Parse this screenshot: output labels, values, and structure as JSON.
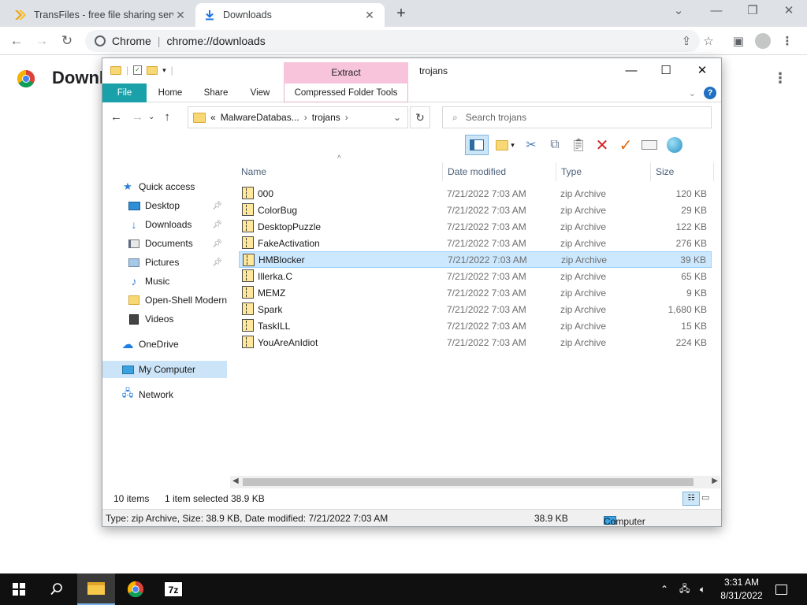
{
  "browser": {
    "tabs": [
      {
        "title": "TransFiles - free file sharing servic",
        "active": false
      },
      {
        "title": "Downloads",
        "active": true
      }
    ],
    "url_prefix": "Chrome",
    "url": "chrome://downloads",
    "page_title": "Downloads"
  },
  "explorer": {
    "title": "trojans",
    "extract_tab": "Extract",
    "ribbon_tabs": [
      "File",
      "Home",
      "Share",
      "View",
      "Compressed Folder Tools"
    ],
    "breadcrumb": [
      "MalwareDatabas...",
      "trojans"
    ],
    "breadcrumb_prefix": "«",
    "search_placeholder": "Search trojans",
    "nav": [
      {
        "label": "Quick access",
        "icon": "star-icon",
        "pinned": false,
        "selected": false
      },
      {
        "label": "Desktop",
        "icon": "desktop-icon",
        "pinned": true,
        "selected": false
      },
      {
        "label": "Downloads",
        "icon": "download-icon",
        "pinned": true,
        "selected": false
      },
      {
        "label": "Documents",
        "icon": "documents-icon",
        "pinned": true,
        "selected": false
      },
      {
        "label": "Pictures",
        "icon": "pictures-icon",
        "pinned": true,
        "selected": false
      },
      {
        "label": "Music",
        "icon": "music-icon",
        "pinned": false,
        "selected": false
      },
      {
        "label": "Open-Shell Modern",
        "icon": "folder-icon",
        "pinned": false,
        "selected": false
      },
      {
        "label": "Videos",
        "icon": "videos-icon",
        "pinned": false,
        "selected": false
      },
      {
        "label": "OneDrive",
        "icon": "cloud-icon",
        "pinned": false,
        "selected": false
      },
      {
        "label": "My Computer",
        "icon": "computer-icon",
        "pinned": false,
        "selected": true
      },
      {
        "label": "Network",
        "icon": "network-icon",
        "pinned": false,
        "selected": false
      }
    ],
    "columns": [
      "Name",
      "Date modified",
      "Type",
      "Size"
    ],
    "files": [
      {
        "name": "000",
        "date": "7/21/2022 7:03 AM",
        "type": "zip Archive",
        "size": "120 KB"
      },
      {
        "name": "ColorBug",
        "date": "7/21/2022 7:03 AM",
        "type": "zip Archive",
        "size": "29 KB"
      },
      {
        "name": "DesktopPuzzle",
        "date": "7/21/2022 7:03 AM",
        "type": "zip Archive",
        "size": "122 KB"
      },
      {
        "name": "FakeActivation",
        "date": "7/21/2022 7:03 AM",
        "type": "zip Archive",
        "size": "276 KB"
      },
      {
        "name": "HMBlocker",
        "date": "7/21/2022 7:03 AM",
        "type": "zip Archive",
        "size": "39 KB"
      },
      {
        "name": "Illerka.C",
        "date": "7/21/2022 7:03 AM",
        "type": "zip Archive",
        "size": "65 KB"
      },
      {
        "name": "MEMZ",
        "date": "7/21/2022 7:03 AM",
        "type": "zip Archive",
        "size": "9 KB"
      },
      {
        "name": "Spark",
        "date": "7/21/2022 7:03 AM",
        "type": "zip Archive",
        "size": "1,680 KB"
      },
      {
        "name": "TaskILL",
        "date": "7/21/2022 7:03 AM",
        "type": "zip Archive",
        "size": "15 KB"
      },
      {
        "name": "YouAreAnIdiot",
        "date": "7/21/2022 7:03 AM",
        "type": "zip Archive",
        "size": "224 KB"
      }
    ],
    "selected_file": "HMBlocker",
    "status": {
      "count": "10 items",
      "selected": "1 item selected",
      "size": "38.9 KB"
    },
    "details": {
      "info": "Type: zip Archive, Size: 38.9 KB, Date modified: 7/21/2022 7:03 AM",
      "size": "38.9 KB",
      "location": "Computer"
    }
  },
  "taskbar": {
    "time": "3:31 AM",
    "date": "8/31/2022",
    "apps": [
      "file-explorer-icon",
      "chrome-icon",
      "7zip-icon"
    ],
    "sevenzip_label": "7z"
  },
  "colors": {
    "file_tab": "#19a0a8",
    "extract_tab": "#f7c4db",
    "selection": "#cce8ff",
    "taskbar": "#101010"
  }
}
